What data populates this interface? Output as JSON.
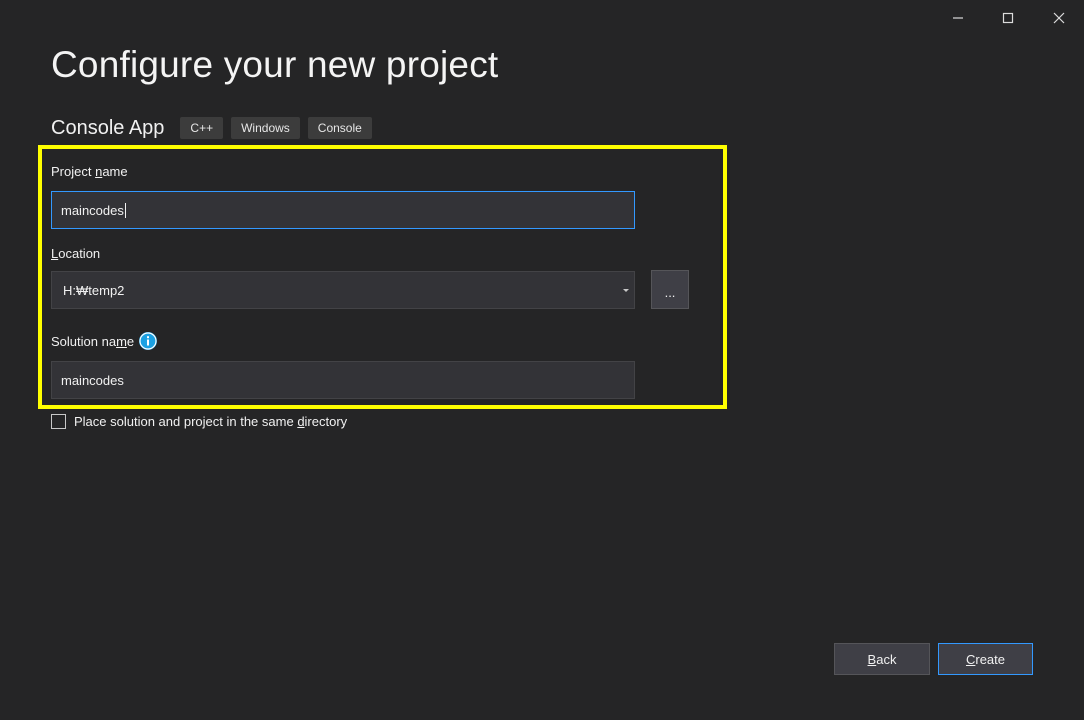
{
  "window": {
    "controls": [
      "minimize-icon",
      "maximize-icon",
      "close-icon"
    ]
  },
  "page": {
    "title": "Configure your new project"
  },
  "template": {
    "name": "Console App",
    "tags": [
      "C++",
      "Windows",
      "Console"
    ]
  },
  "form": {
    "project_name": {
      "label_pre": "Project ",
      "label_key": "n",
      "label_post": "ame",
      "value": "maincodes"
    },
    "location": {
      "label_pre": "",
      "label_key": "L",
      "label_post": "ocation",
      "value": "H:₩temp2",
      "browse_label": "..."
    },
    "solution_name": {
      "label_pre": "Solution na",
      "label_key": "m",
      "label_post": "e",
      "value": "maincodes",
      "info_icon": "info-icon"
    },
    "same_directory": {
      "label_pre": "Place solution and project in the same ",
      "label_key": "d",
      "label_post": "irectory",
      "checked": false
    }
  },
  "footer": {
    "back": {
      "key": "B",
      "rest": "ack"
    },
    "create": {
      "key": "C",
      "rest": "reate"
    }
  },
  "colors": {
    "background": "#252526",
    "accent": "#3399ff",
    "highlight": "#ffff00",
    "info": "#1ba1e2"
  }
}
